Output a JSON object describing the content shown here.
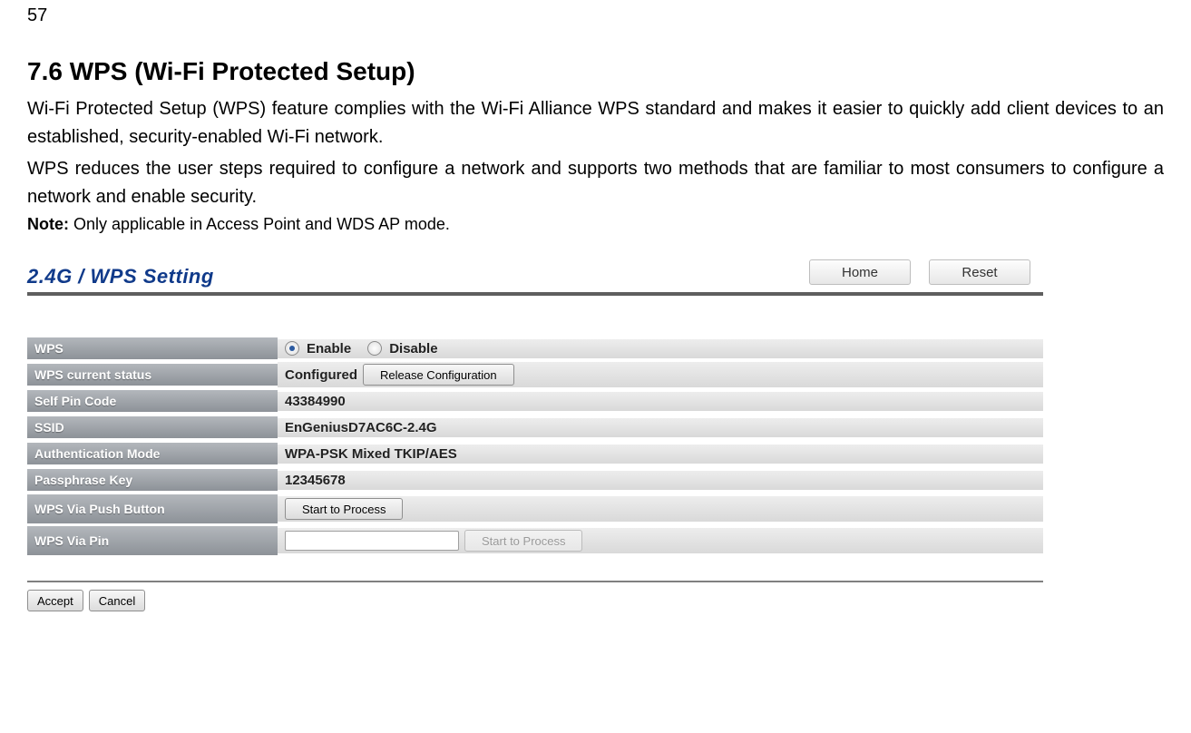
{
  "page_number": "57",
  "heading": "7.6   WPS (Wi-Fi Protected Setup)",
  "para1": "Wi-Fi Protected Setup (WPS) feature complies with the Wi-Fi Alliance WPS standard and makes it easier to quickly add client devices to an established, security-enabled Wi-Fi network.",
  "para2": "WPS reduces the user steps required to configure a network and supports two methods that are familiar to most consumers to configure a network and enable security.",
  "note_label": "Note:",
  "note_text": " Only applicable in Access Point and WDS AP mode.",
  "shot": {
    "title": "2.4G / WPS Setting",
    "home_btn": "Home",
    "reset_btn": "Reset",
    "rows": {
      "wps_label": "WPS",
      "enable": "Enable",
      "disable": "Disable",
      "status_label": "WPS current status",
      "status_value": "Configured",
      "release_btn": "Release Configuration",
      "pin_label": "Self Pin Code",
      "pin_value": "43384990",
      "ssid_label": "SSID",
      "ssid_value": "EnGeniusD7AC6C-2.4G",
      "auth_label": "Authentication Mode",
      "auth_value": "WPA-PSK Mixed TKIP/AES",
      "pass_label": "Passphrase Key",
      "pass_value": "12345678",
      "push_label": "WPS Via Push Button",
      "push_btn": "Start to Process",
      "viapin_label": "WPS Via Pin",
      "viapin_btn": "Start to Process"
    },
    "accept_btn": "Accept",
    "cancel_btn": "Cancel"
  }
}
